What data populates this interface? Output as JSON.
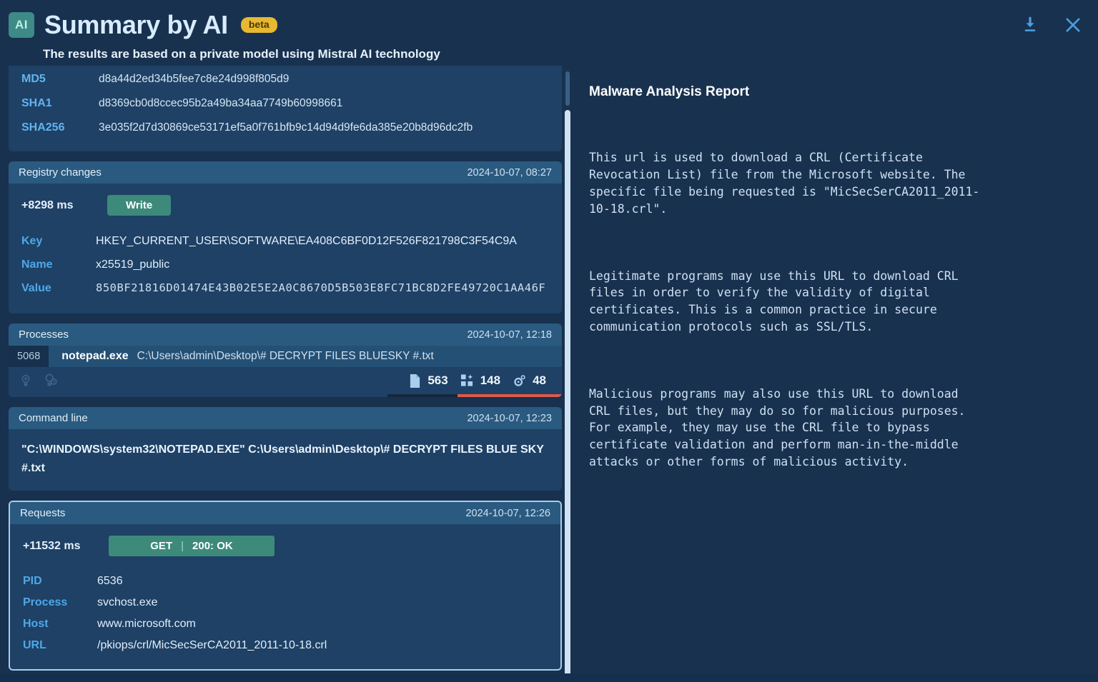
{
  "header": {
    "badge_text": "AI",
    "title": "Summary by AI",
    "beta_label": "beta",
    "subtitle": "The results are based on a private model using Mistral AI technology",
    "download_icon": "download-icon",
    "close_icon": "close-icon"
  },
  "colors": {
    "page_bg": "#18314f",
    "card_bg": "#1e4165",
    "card_head_bg": "#2a5a80",
    "accent_key": "#4fa8e8",
    "badge_teal": "#3d8a86",
    "beta_yellow": "#e8b830",
    "tag_green": "#3d8a7b",
    "bar_red": "#e05a47",
    "selected_border": "#aacdea"
  },
  "hashes": [
    {
      "key": "MD5",
      "value": "d8a44d2ed34b5fee7c8e24d998f805d9"
    },
    {
      "key": "SHA1",
      "value": "d8369cb0d8ccec95b2a49ba34aa7749b60998661"
    },
    {
      "key": "SHA256",
      "value": "3e035f2d7d30869ce53171ef5a0f761bfb9c14d94d9fe6da385e20b8d96dc2fb"
    }
  ],
  "registry": {
    "title": "Registry changes",
    "timestamp": "2024-10-07, 08:27",
    "offset": "+8298 ms",
    "operation": "Write",
    "rows": [
      {
        "key": "Key",
        "value": "HKEY_CURRENT_USER\\SOFTWARE\\EA408C6BF0D12F526F821798C3F54C9A"
      },
      {
        "key": "Name",
        "value": "x25519_public"
      },
      {
        "key": "Value",
        "value": "850BF21816D01474E43B02E5E2A0C8670D5B503E8FC71BC8D2FE49720C1AA46F"
      }
    ]
  },
  "processes": {
    "title": "Processes",
    "timestamp": "2024-10-07, 12:18",
    "pid": "5068",
    "name": "notepad.exe",
    "path": "C:\\Users\\admin\\Desktop\\# DECRYPT FILES BLUESKY #.txt",
    "stats": [
      {
        "icon": "file-icon",
        "value": "563"
      },
      {
        "icon": "modules-icon",
        "value": "148"
      },
      {
        "icon": "gear-icon",
        "value": "48"
      }
    ],
    "left_icons": [
      "medal-icon",
      "medal-gear-icon"
    ]
  },
  "command_line": {
    "title": "Command line",
    "timestamp": "2024-10-07, 12:23",
    "value": "\"C:\\WINDOWS\\system32\\NOTEPAD.EXE\" C:\\Users\\admin\\Desktop\\# DECRYPT FILES BLUE SKY #.txt"
  },
  "requests": {
    "title": "Requests",
    "timestamp": "2024-10-07, 12:26",
    "offset": "+11532 ms",
    "method": "GET",
    "status": "200: OK",
    "rows": [
      {
        "key": "PID",
        "value": "6536"
      },
      {
        "key": "Process",
        "value": "svchost.exe"
      },
      {
        "key": "Host",
        "value": "www.microsoft.com"
      },
      {
        "key": "URL",
        "value": "/pkiops/crl/MicSecSerCA2011_2011-10-18.crl"
      }
    ]
  },
  "report": {
    "title": "Malware Analysis Report",
    "paragraphs": [
      "This url is used to download a CRL (Certificate\nRevocation List) file from the Microsoft website. The\nspecific file being requested is \"MicSecSerCA2011_2011-\n10-18.crl\".",
      "Legitimate programs may use this URL to download CRL\nfiles in order to verify the validity of digital\ncertificates. This is a common practice in secure\ncommunication protocols such as SSL/TLS.",
      "Malicious programs may also use this URL to download\nCRL files, but they may do so for malicious purposes.\nFor example, they may use the CRL file to bypass\ncertificate validation and perform man-in-the-middle\nattacks or other forms of malicious activity."
    ]
  }
}
